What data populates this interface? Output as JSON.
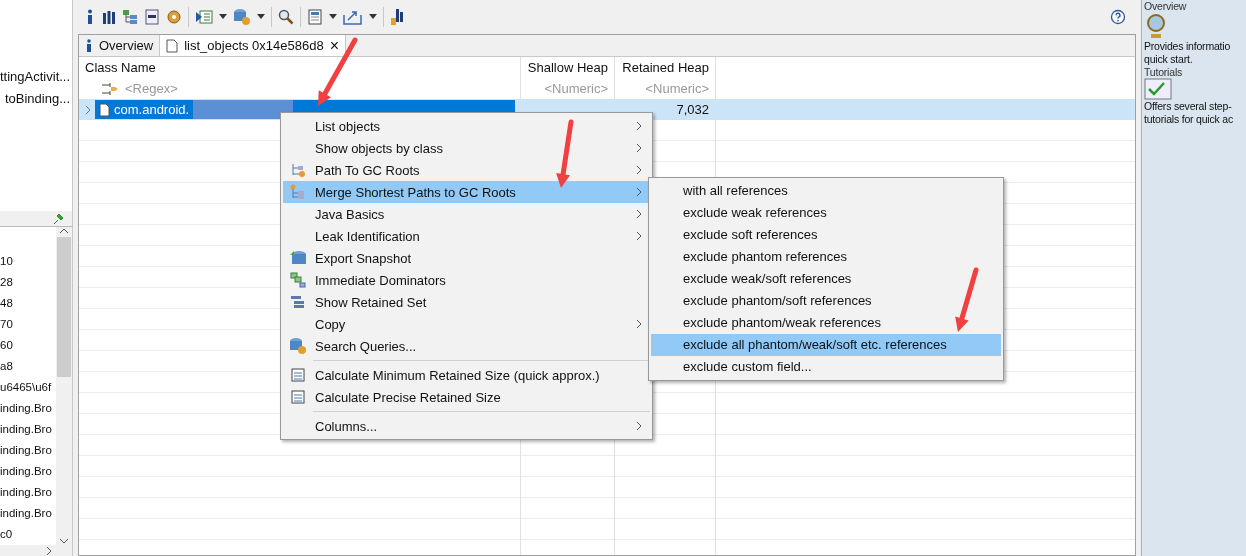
{
  "left_panel": {
    "upper_items": [
      "ttingActivit...",
      "toBinding..."
    ],
    "lower_items": [
      "10",
      "28",
      "48",
      "70",
      "60",
      "a8",
      "u6465\\u6f",
      "inding.Bro",
      "inding.Bro",
      "inding.Bro",
      "inding.Bro",
      "inding.Bro",
      "inding.Bro",
      "c0"
    ]
  },
  "tabs": [
    {
      "label": "Overview",
      "selected": false,
      "closable": false
    },
    {
      "label": "list_objects 0x14e586d8",
      "selected": true,
      "closable": true
    }
  ],
  "close_glyph": "×",
  "table": {
    "columns": [
      "Class Name",
      "Shallow Heap",
      "Retained Heap"
    ],
    "filters": [
      "<Regex>",
      "<Numeric>",
      "<Numeric>"
    ],
    "rows": [
      {
        "class_name": "com.android.",
        "redacted": true,
        "retained_heap": "7,032",
        "selected": true
      }
    ]
  },
  "context_menu": [
    {
      "kind": "item",
      "label": "List objects",
      "submenu": true,
      "selected": false
    },
    {
      "kind": "item",
      "label": "Show objects by class",
      "submenu": true,
      "selected": false
    },
    {
      "kind": "item",
      "label": "Path To GC Roots",
      "submenu": true,
      "selected": false
    },
    {
      "kind": "item",
      "label": "Merge Shortest Paths to GC Roots",
      "submenu": true,
      "selected": true
    },
    {
      "kind": "item",
      "label": "Java Basics",
      "submenu": true,
      "selected": false
    },
    {
      "kind": "item",
      "label": "Leak Identification",
      "submenu": true,
      "selected": false
    },
    {
      "kind": "item",
      "label": "Export Snapshot",
      "submenu": false,
      "selected": false
    },
    {
      "kind": "item",
      "label": "Immediate Dominators",
      "submenu": false,
      "selected": false
    },
    {
      "kind": "item",
      "label": "Show Retained Set",
      "submenu": false,
      "selected": false
    },
    {
      "kind": "item",
      "label": "Copy",
      "submenu": true,
      "selected": false
    },
    {
      "kind": "item",
      "label": "Search Queries...",
      "submenu": false,
      "selected": false
    },
    {
      "kind": "separator"
    },
    {
      "kind": "item",
      "label": "Calculate Minimum Retained Size (quick approx.)",
      "submenu": false,
      "selected": false
    },
    {
      "kind": "item",
      "label": "Calculate Precise Retained Size",
      "submenu": false,
      "selected": false
    },
    {
      "kind": "separator"
    },
    {
      "kind": "item",
      "label": "Columns...",
      "submenu": true,
      "selected": false
    }
  ],
  "submenu": [
    {
      "label": "with all references",
      "selected": false
    },
    {
      "label": "exclude weak references",
      "selected": false
    },
    {
      "label": "exclude soft references",
      "selected": false
    },
    {
      "label": "exclude phantom references",
      "selected": false
    },
    {
      "label": "exclude weak/soft references",
      "selected": false
    },
    {
      "label": "exclude phantom/soft references",
      "selected": false
    },
    {
      "label": "exclude phantom/weak references",
      "selected": false
    },
    {
      "label": "exclude all phantom/weak/soft etc. references",
      "selected": true
    },
    {
      "label": "exclude custom field...",
      "selected": false
    }
  ],
  "right_panel": [
    {
      "title": "Overview",
      "lines": [
        "Provides informatio",
        "quick start."
      ]
    },
    {
      "title": "Tutorials",
      "lines": [
        "Offers several step-",
        "tutorials for quick ac"
      ]
    }
  ]
}
